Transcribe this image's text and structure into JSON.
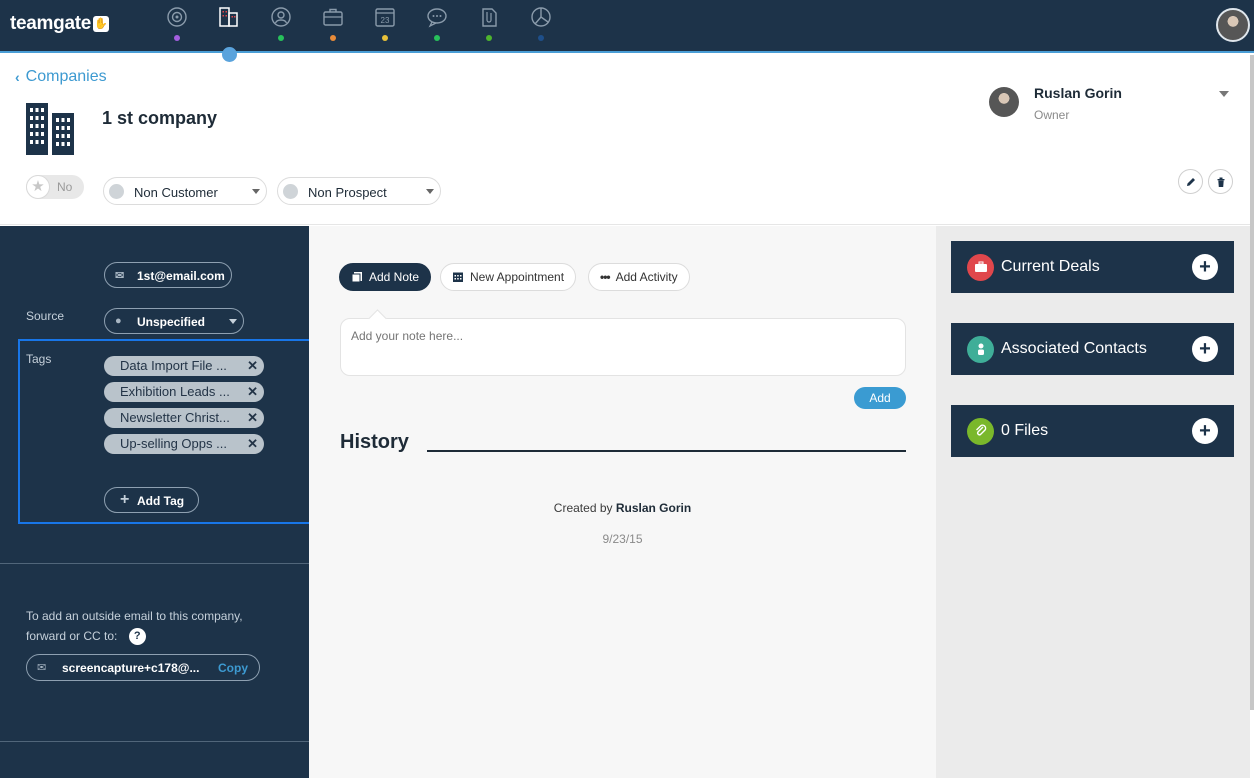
{
  "app": {
    "logo_text": "teamgate",
    "logo_mark": "✋"
  },
  "nav": {
    "items": [
      {
        "name": "dashboard-icon",
        "dot": "#a45fe0"
      },
      {
        "name": "companies-icon",
        "dot": "#ffffff"
      },
      {
        "name": "contacts-icon",
        "dot": "#27c15b"
      },
      {
        "name": "deals-icon",
        "dot": "#e88b39"
      },
      {
        "name": "calendar-icon",
        "dot": "#e8c139",
        "label": "23"
      },
      {
        "name": "chat-icon",
        "dot": "#27c15b"
      },
      {
        "name": "files-icon",
        "dot": "#4eb52e"
      },
      {
        "name": "reports-icon",
        "dot": "#1e4f8a"
      }
    ]
  },
  "header": {
    "back_label": "Companies",
    "company_name": "1 st company",
    "owner": {
      "name": "Ruslan Gorin",
      "role": "Owner"
    },
    "favorite_label": "No",
    "customer_status": "Non Customer",
    "prospect_status": "Non Prospect"
  },
  "left": {
    "email": "1st@email.com",
    "source_label": "Source",
    "source_value": "Unspecified",
    "tags_label": "Tags",
    "tags": [
      "Data Import File ...",
      "Exhibition Leads ...",
      "Newsletter Christ...",
      "Up-selling Opps ..."
    ],
    "add_tag_label": "Add Tag",
    "forward_info": "To add an outside email to this company, forward or CC to:",
    "help_label": "?",
    "forward_email": "screencapture+c178@...",
    "copy_label": "Copy"
  },
  "center": {
    "actions": {
      "add_note": "Add Note",
      "new_appointment": "New Appointment",
      "add_activity": "Add Activity"
    },
    "note_placeholder": "Add your note here...",
    "add_button": "Add",
    "history_title": "History",
    "created_by_prefix": "Created by",
    "created_by_name": "Ruslan Gorin",
    "created_date": "9/23/15"
  },
  "right": {
    "cards": [
      {
        "label": "Current Deals",
        "color": "#e0474c"
      },
      {
        "label": "Associated Contacts",
        "color": "#3fae98"
      },
      {
        "label": "0 Files",
        "color": "#7ab82b"
      }
    ]
  }
}
